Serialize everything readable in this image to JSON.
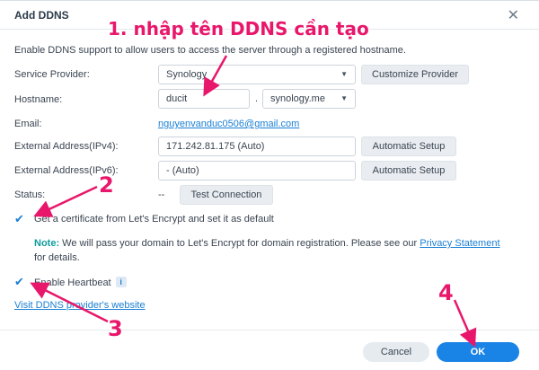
{
  "dialog": {
    "title": "Add DDNS",
    "description": "Enable DDNS support to allow users to access the server through a registered hostname."
  },
  "form": {
    "service_provider": {
      "label": "Service Provider:",
      "value": "Synology",
      "button": "Customize Provider"
    },
    "hostname": {
      "label": "Hostname:",
      "value": "ducit",
      "separator": ".",
      "domain": "synology.me"
    },
    "email": {
      "label": "Email:",
      "value": "nguyenvanduc0506@gmail.com"
    },
    "ipv4": {
      "label": "External Address(IPv4):",
      "value": "171.242.81.175 (Auto)",
      "button": "Automatic Setup"
    },
    "ipv6": {
      "label": "External Address(IPv6):",
      "value": "- (Auto)",
      "button": "Automatic Setup"
    },
    "status": {
      "label": "Status:",
      "value": "--",
      "button": "Test Connection"
    },
    "certificate": {
      "label": "Get a certificate from Let's Encrypt and set it as default",
      "checked": true
    },
    "note": {
      "prefix": "Note:",
      "text": " We will pass your domain to Let's Encrypt for domain registration. Please see our ",
      "link": "Privacy Statement",
      "suffix": " for details."
    },
    "heartbeat": {
      "label": "Enable Heartbeat",
      "checked": true
    },
    "provider_link": "Visit DDNS provider's website"
  },
  "footer": {
    "cancel": "Cancel",
    "ok": "OK"
  },
  "annotations": {
    "a1": "1. nhập tên DDNS cần tạo",
    "a2": "2",
    "a3": "3",
    "a4": "4",
    "color": "#e8176b"
  },
  "icons": {
    "close": "close-icon",
    "caret": "chevron-down-icon",
    "check": "checkmark-icon",
    "info": "info-icon"
  }
}
